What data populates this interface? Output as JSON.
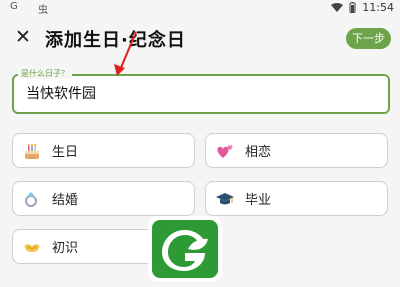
{
  "status_bar": {
    "time": "11:54",
    "indicator_1": "G",
    "indicator_2": "虫"
  },
  "app_bar": {
    "title": "添加生日·纪念日",
    "next_label": "下一步"
  },
  "name_field": {
    "label": "是什么日子？",
    "value": "当快软件园"
  },
  "options": [
    {
      "label": "生日",
      "icon": "cake-icon"
    },
    {
      "label": "相恋",
      "icon": "hearts-icon"
    },
    {
      "label": "结婚",
      "icon": "ring-icon"
    },
    {
      "label": "毕业",
      "icon": "graduation-cap-icon"
    },
    {
      "label": "初识",
      "icon": "handshake-icon"
    }
  ],
  "colors": {
    "accent": "#6da34a",
    "arrow": "#e02020",
    "border": "#cfcfcf",
    "background": "#f5f5f5"
  }
}
